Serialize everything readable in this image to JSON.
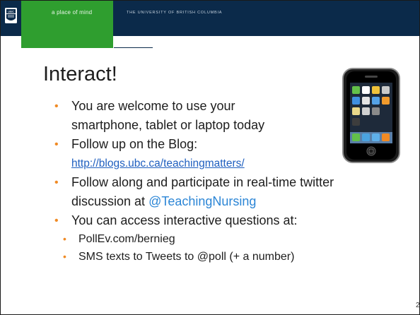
{
  "header": {
    "logo": "UBC",
    "motto": "a place of mind",
    "university": "THE UNIVERSITY OF BRITISH COLUMBIA"
  },
  "slide": {
    "title": "Interact!",
    "bullets": [
      {
        "line1": "You are welcome to use your",
        "line2": "smartphone,  tablet or laptop today"
      },
      {
        "line1": "Follow up on the Blog:",
        "link": "http://blogs.ubc.ca/teachingmatters/"
      },
      {
        "line1": "Follow along and participate in real-time twitter",
        "line2_prefix": "discussion at ",
        "handle": "@TeachingNursing"
      },
      {
        "line1": "You can access interactive questions at:"
      }
    ],
    "sub_bullets": [
      "PollEv.com/bernieg",
      "SMS texts to Tweets to @poll (+ a number)"
    ],
    "page_number": "2"
  },
  "image": {
    "icon": "smartphone-icon"
  },
  "colors": {
    "banner": "#0b2a4a",
    "green": "#2f9e2f",
    "bullet": "#f08a24",
    "link": "#1f5fbf"
  }
}
